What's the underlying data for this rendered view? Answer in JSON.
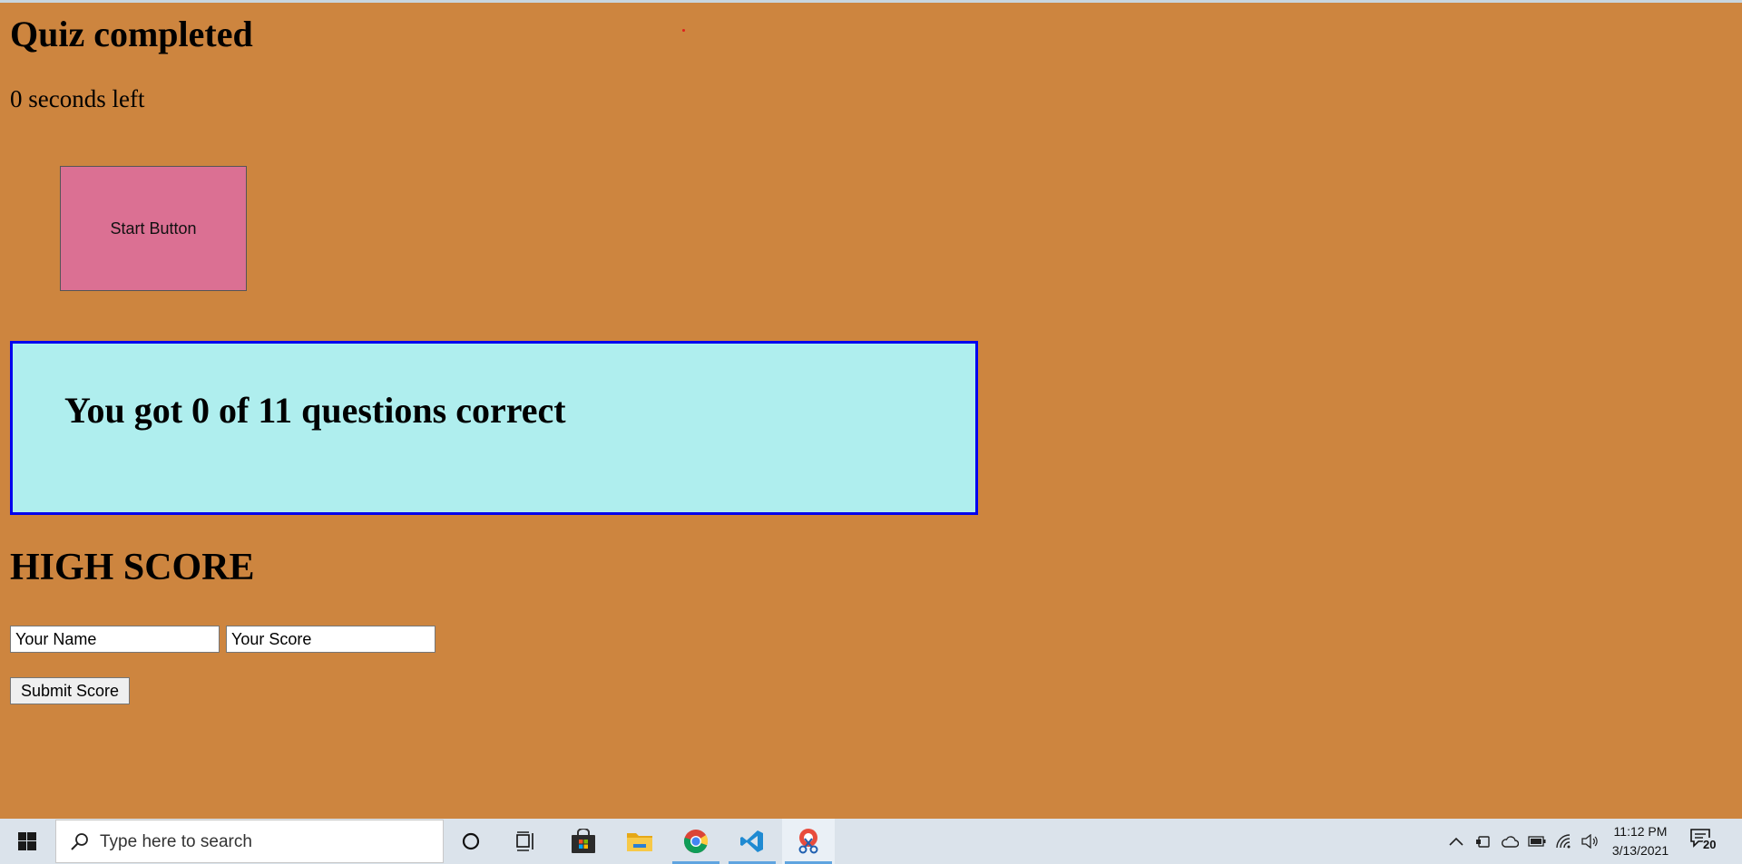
{
  "page": {
    "title": "Quiz completed",
    "timer_text": "0 seconds left",
    "start_button_label": "Start Button",
    "result_text": "You got 0 of 11 questions correct",
    "high_score_heading": "HIGH SCORE",
    "name_placeholder": "Your Name",
    "score_placeholder": "Your Score",
    "submit_label": "Submit Score"
  },
  "colors": {
    "background": "#cd853f",
    "start_button": "#db7093",
    "result_box": "#afeeee",
    "result_border": "#0000ee"
  },
  "taskbar": {
    "search_placeholder": "Type here to search",
    "time": "11:12 PM",
    "date": "3/13/2021",
    "notification_count": "20",
    "pinned_apps": [
      "cortana-icon",
      "task-view-icon",
      "store-icon",
      "file-explorer-icon",
      "chrome-icon",
      "vscode-icon",
      "snipping-tool-icon"
    ]
  }
}
